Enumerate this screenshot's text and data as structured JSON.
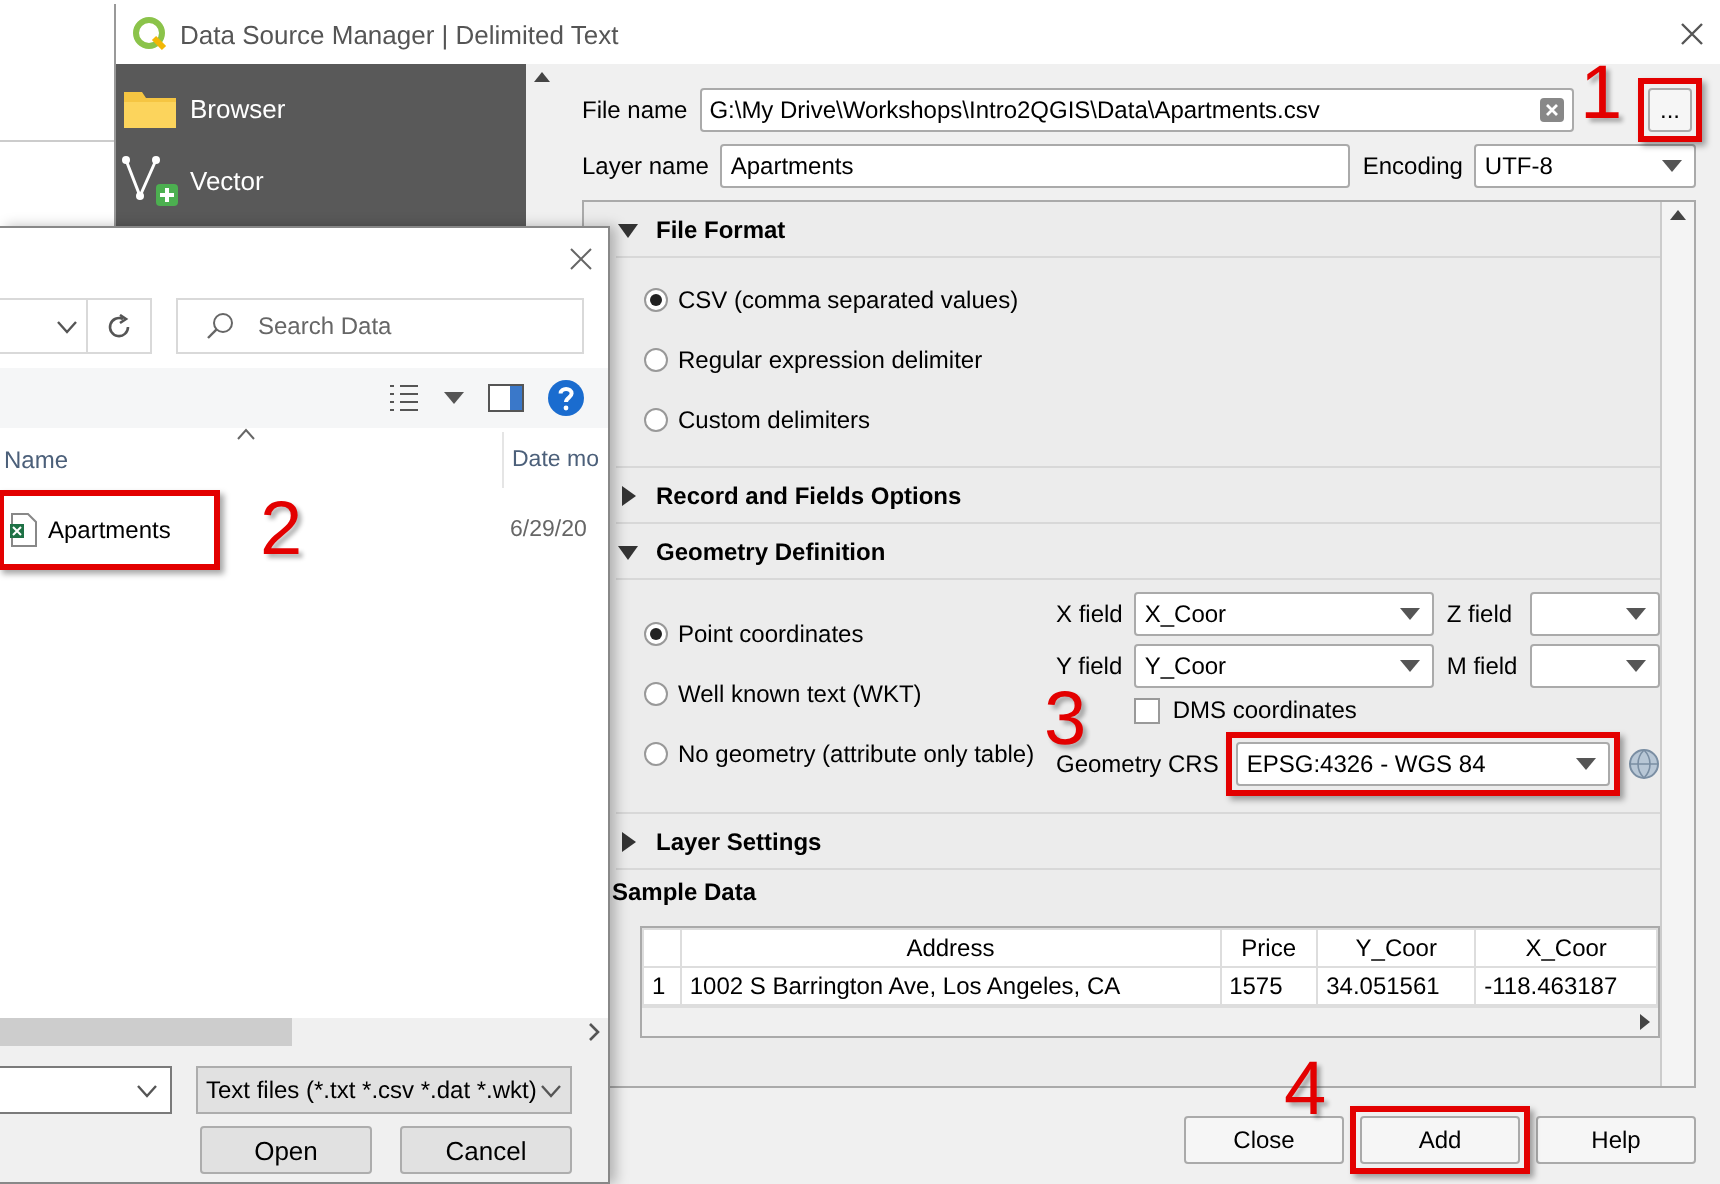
{
  "qgis_dialog": {
    "title": "Data Source Manager | Delimited Text",
    "sidebar": [
      {
        "label": "Browser",
        "kind": "folder"
      },
      {
        "label": "Vector",
        "kind": "vector"
      }
    ],
    "file_name": {
      "label": "File name",
      "value": "G:\\My Drive\\Workshops\\Intro2QGIS\\Data\\Apartments.csv"
    },
    "browse_button": "...",
    "layer_name": {
      "label": "Layer name",
      "value": "Apartments"
    },
    "encoding": {
      "label": "Encoding",
      "value": "UTF-8"
    },
    "file_format": {
      "title": "File Format",
      "expanded": true,
      "options": [
        {
          "label": "CSV (comma separated values)",
          "selected": true
        },
        {
          "label": "Regular expression delimiter",
          "selected": false
        },
        {
          "label": "Custom delimiters",
          "selected": false
        }
      ]
    },
    "record_options": {
      "title": "Record and Fields Options",
      "expanded": false
    },
    "geometry": {
      "title": "Geometry Definition",
      "expanded": true,
      "options": [
        {
          "label": "Point coordinates",
          "selected": true
        },
        {
          "label": "Well known text (WKT)",
          "selected": false
        },
        {
          "label": "No geometry (attribute only table)",
          "selected": false
        }
      ],
      "x_field": {
        "label": "X field",
        "value": "X_Coor"
      },
      "y_field": {
        "label": "Y field",
        "value": "Y_Coor"
      },
      "z_field": {
        "label": "Z field"
      },
      "m_field": {
        "label": "M field"
      },
      "dms": {
        "label": "DMS coordinates",
        "checked": false
      },
      "crs": {
        "label": "Geometry CRS",
        "value": "EPSG:4326 - WGS 84"
      }
    },
    "layer_settings": {
      "title": "Layer Settings",
      "expanded": false
    },
    "sample_data": {
      "title": "Sample Data",
      "columns": [
        "Address",
        "Price",
        "Y_Coor",
        "X_Coor"
      ],
      "rows": [
        {
          "number": "1",
          "cells": [
            "1002 S Barrington Ave, Los Angeles, CA",
            "1575",
            "34.051561",
            "-118.463187"
          ]
        }
      ]
    },
    "buttons": [
      "Close",
      "Add",
      "Help"
    ]
  },
  "file_dialog": {
    "search_placeholder": "Search Data",
    "columns": [
      "Name",
      "Date mo"
    ],
    "files": [
      {
        "name": "Apartments",
        "date": "6/29/20"
      }
    ],
    "file_type": "Text files (*.txt *.csv *.dat *.wkt)",
    "buttons": [
      "Open",
      "Cancel"
    ]
  },
  "callouts": [
    "1",
    "2",
    "3",
    "4"
  ]
}
